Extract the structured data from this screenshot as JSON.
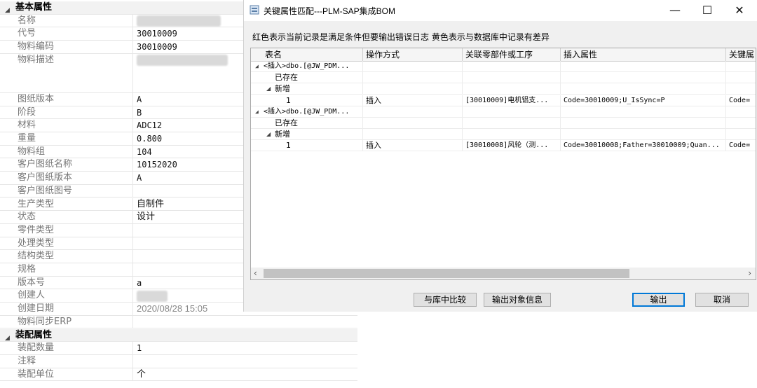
{
  "properties": {
    "basic_title": "基本属性",
    "rows": [
      {
        "label": "名称",
        "value": "",
        "redacted": true
      },
      {
        "label": "代号",
        "value": "30010009"
      },
      {
        "label": "物料编码",
        "value": "30010009"
      },
      {
        "label": "物料描述",
        "value": "",
        "redacted": true
      },
      {
        "label": "图纸版本",
        "value": "A"
      },
      {
        "label": "阶段",
        "value": "B"
      },
      {
        "label": "材料",
        "value": "ADC12"
      },
      {
        "label": "重量",
        "value": "0.800"
      },
      {
        "label": "物料组",
        "value": "104"
      },
      {
        "label": "客户图纸名称",
        "value": "10152020"
      },
      {
        "label": "客户图纸版本",
        "value": "A"
      },
      {
        "label": "客户图纸图号",
        "value": ""
      },
      {
        "label": "生产类型",
        "value": "自制件"
      },
      {
        "label": "状态",
        "value": "设计"
      },
      {
        "label": "零件类型",
        "value": ""
      },
      {
        "label": "处理类型",
        "value": ""
      },
      {
        "label": "结构类型",
        "value": ""
      },
      {
        "label": "规格",
        "value": ""
      },
      {
        "label": "版本号",
        "value": "a"
      },
      {
        "label": "创建人",
        "value": "",
        "redacted": true
      },
      {
        "label": "创建日期",
        "value": "2020/08/28 15:05"
      },
      {
        "label": "物料同步ERP",
        "value": ""
      }
    ],
    "assembly_title": "装配属性",
    "assembly_rows": [
      {
        "label": "装配数量",
        "value": "1"
      },
      {
        "label": "注释",
        "value": ""
      },
      {
        "label": "装配单位",
        "value": "个"
      }
    ]
  },
  "dialog": {
    "title": "关键属性匹配---PLM-SAP集成BOM",
    "minimize": "—",
    "maximize": "☐",
    "close": "✕",
    "hint": "红色表示当前记录是满足条件但要输出错误日志 黄色表示与数据库中记录有差异",
    "columns": [
      "表名",
      "操作方式",
      "关联零部件或工序",
      "插入属性",
      "关键属"
    ],
    "tree": [
      {
        "level": 0,
        "expanded": true,
        "name": "<插入>dbo.[@JW_PDM...",
        "op": "",
        "rel": "",
        "attr": "",
        "key": ""
      },
      {
        "level": 1,
        "expanded": null,
        "name": "已存在",
        "op": "",
        "rel": "",
        "attr": "",
        "key": ""
      },
      {
        "level": 1,
        "expanded": true,
        "name": "新增",
        "op": "",
        "rel": "",
        "attr": "",
        "key": ""
      },
      {
        "level": 2,
        "expanded": null,
        "name": "1",
        "op": "插入",
        "rel": "[30010009]电机铝支...",
        "attr": "Code=30010009;U_IsSync=P",
        "key": "Code="
      },
      {
        "level": 0,
        "expanded": true,
        "name": "<插入>dbo.[@JW_PDM...",
        "op": "",
        "rel": "",
        "attr": "",
        "key": ""
      },
      {
        "level": 1,
        "expanded": null,
        "name": "已存在",
        "op": "",
        "rel": "",
        "attr": "",
        "key": ""
      },
      {
        "level": 1,
        "expanded": true,
        "name": "新增",
        "op": "",
        "rel": "",
        "attr": "",
        "key": ""
      },
      {
        "level": 2,
        "expanded": null,
        "name": "1",
        "op": "插入",
        "rel": "[30010008]风轮（测...",
        "attr": "Code=30010008;Father=30010009;Quan...",
        "key": "Code="
      }
    ],
    "buttons": {
      "compare": "与库中比较",
      "export_info": "输出对象信息",
      "output": "输出",
      "cancel": "取消"
    },
    "scroll_left": "‹",
    "scroll_right": "›"
  }
}
